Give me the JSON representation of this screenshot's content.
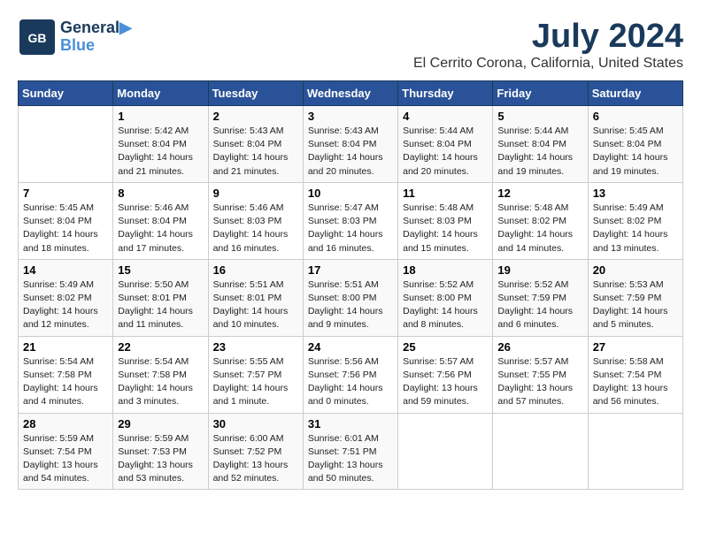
{
  "header": {
    "logo_line1": "General",
    "logo_line2": "Blue",
    "month": "July 2024",
    "location": "El Cerrito Corona, California, United States"
  },
  "weekdays": [
    "Sunday",
    "Monday",
    "Tuesday",
    "Wednesday",
    "Thursday",
    "Friday",
    "Saturday"
  ],
  "weeks": [
    [
      {
        "day": "",
        "info": ""
      },
      {
        "day": "1",
        "info": "Sunrise: 5:42 AM\nSunset: 8:04 PM\nDaylight: 14 hours\nand 21 minutes."
      },
      {
        "day": "2",
        "info": "Sunrise: 5:43 AM\nSunset: 8:04 PM\nDaylight: 14 hours\nand 21 minutes."
      },
      {
        "day": "3",
        "info": "Sunrise: 5:43 AM\nSunset: 8:04 PM\nDaylight: 14 hours\nand 20 minutes."
      },
      {
        "day": "4",
        "info": "Sunrise: 5:44 AM\nSunset: 8:04 PM\nDaylight: 14 hours\nand 20 minutes."
      },
      {
        "day": "5",
        "info": "Sunrise: 5:44 AM\nSunset: 8:04 PM\nDaylight: 14 hours\nand 19 minutes."
      },
      {
        "day": "6",
        "info": "Sunrise: 5:45 AM\nSunset: 8:04 PM\nDaylight: 14 hours\nand 19 minutes."
      }
    ],
    [
      {
        "day": "7",
        "info": "Sunrise: 5:45 AM\nSunset: 8:04 PM\nDaylight: 14 hours\nand 18 minutes."
      },
      {
        "day": "8",
        "info": "Sunrise: 5:46 AM\nSunset: 8:04 PM\nDaylight: 14 hours\nand 17 minutes."
      },
      {
        "day": "9",
        "info": "Sunrise: 5:46 AM\nSunset: 8:03 PM\nDaylight: 14 hours\nand 16 minutes."
      },
      {
        "day": "10",
        "info": "Sunrise: 5:47 AM\nSunset: 8:03 PM\nDaylight: 14 hours\nand 16 minutes."
      },
      {
        "day": "11",
        "info": "Sunrise: 5:48 AM\nSunset: 8:03 PM\nDaylight: 14 hours\nand 15 minutes."
      },
      {
        "day": "12",
        "info": "Sunrise: 5:48 AM\nSunset: 8:02 PM\nDaylight: 14 hours\nand 14 minutes."
      },
      {
        "day": "13",
        "info": "Sunrise: 5:49 AM\nSunset: 8:02 PM\nDaylight: 14 hours\nand 13 minutes."
      }
    ],
    [
      {
        "day": "14",
        "info": "Sunrise: 5:49 AM\nSunset: 8:02 PM\nDaylight: 14 hours\nand 12 minutes."
      },
      {
        "day": "15",
        "info": "Sunrise: 5:50 AM\nSunset: 8:01 PM\nDaylight: 14 hours\nand 11 minutes."
      },
      {
        "day": "16",
        "info": "Sunrise: 5:51 AM\nSunset: 8:01 PM\nDaylight: 14 hours\nand 10 minutes."
      },
      {
        "day": "17",
        "info": "Sunrise: 5:51 AM\nSunset: 8:00 PM\nDaylight: 14 hours\nand 9 minutes."
      },
      {
        "day": "18",
        "info": "Sunrise: 5:52 AM\nSunset: 8:00 PM\nDaylight: 14 hours\nand 8 minutes."
      },
      {
        "day": "19",
        "info": "Sunrise: 5:52 AM\nSunset: 7:59 PM\nDaylight: 14 hours\nand 6 minutes."
      },
      {
        "day": "20",
        "info": "Sunrise: 5:53 AM\nSunset: 7:59 PM\nDaylight: 14 hours\nand 5 minutes."
      }
    ],
    [
      {
        "day": "21",
        "info": "Sunrise: 5:54 AM\nSunset: 7:58 PM\nDaylight: 14 hours\nand 4 minutes."
      },
      {
        "day": "22",
        "info": "Sunrise: 5:54 AM\nSunset: 7:58 PM\nDaylight: 14 hours\nand 3 minutes."
      },
      {
        "day": "23",
        "info": "Sunrise: 5:55 AM\nSunset: 7:57 PM\nDaylight: 14 hours\nand 1 minute."
      },
      {
        "day": "24",
        "info": "Sunrise: 5:56 AM\nSunset: 7:56 PM\nDaylight: 14 hours\nand 0 minutes."
      },
      {
        "day": "25",
        "info": "Sunrise: 5:57 AM\nSunset: 7:56 PM\nDaylight: 13 hours\nand 59 minutes."
      },
      {
        "day": "26",
        "info": "Sunrise: 5:57 AM\nSunset: 7:55 PM\nDaylight: 13 hours\nand 57 minutes."
      },
      {
        "day": "27",
        "info": "Sunrise: 5:58 AM\nSunset: 7:54 PM\nDaylight: 13 hours\nand 56 minutes."
      }
    ],
    [
      {
        "day": "28",
        "info": "Sunrise: 5:59 AM\nSunset: 7:54 PM\nDaylight: 13 hours\nand 54 minutes."
      },
      {
        "day": "29",
        "info": "Sunrise: 5:59 AM\nSunset: 7:53 PM\nDaylight: 13 hours\nand 53 minutes."
      },
      {
        "day": "30",
        "info": "Sunrise: 6:00 AM\nSunset: 7:52 PM\nDaylight: 13 hours\nand 52 minutes."
      },
      {
        "day": "31",
        "info": "Sunrise: 6:01 AM\nSunset: 7:51 PM\nDaylight: 13 hours\nand 50 minutes."
      },
      {
        "day": "",
        "info": ""
      },
      {
        "day": "",
        "info": ""
      },
      {
        "day": "",
        "info": ""
      }
    ]
  ]
}
